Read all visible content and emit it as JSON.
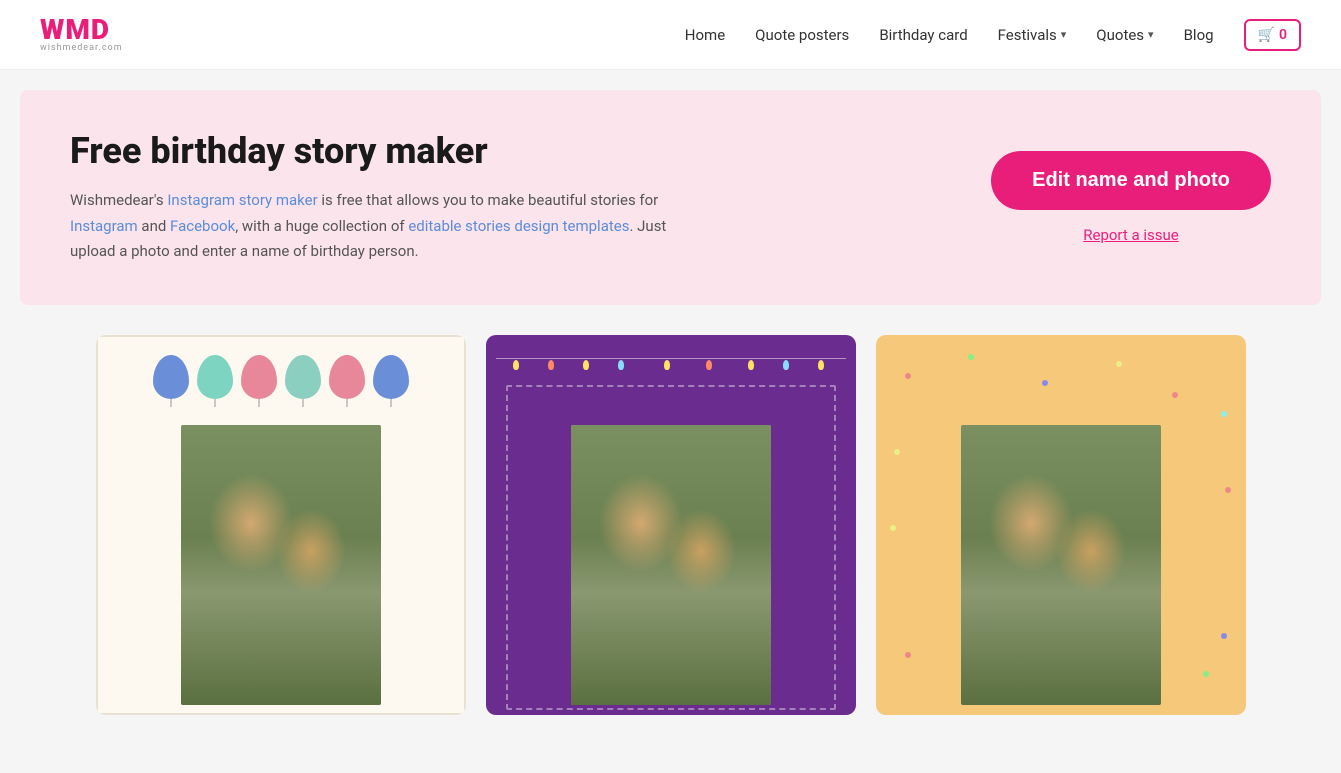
{
  "header": {
    "logo_text": "WMD",
    "logo_sub": "wishmedear.com",
    "nav": {
      "home": "Home",
      "quote_posters": "Quote posters",
      "birthday_card": "Birthday card",
      "festivals": "Festivals",
      "quotes": "Quotes",
      "blog": "Blog",
      "cart_count": "0"
    }
  },
  "hero": {
    "title": "Free birthday story maker",
    "description": "Wishmedear's Instagram story maker is free that allows you to make beautiful stories for Instagram and Facebook, with a huge collection of editable stories design templates. Just upload a photo and enter a name of birthday person.",
    "edit_button": "Edit name and photo",
    "report_link": "Report a issue"
  },
  "cards": [
    {
      "id": "card-1",
      "theme": "cream-balloons"
    },
    {
      "id": "card-2",
      "theme": "purple-lights"
    },
    {
      "id": "card-3",
      "theme": "peach-confetti"
    }
  ]
}
